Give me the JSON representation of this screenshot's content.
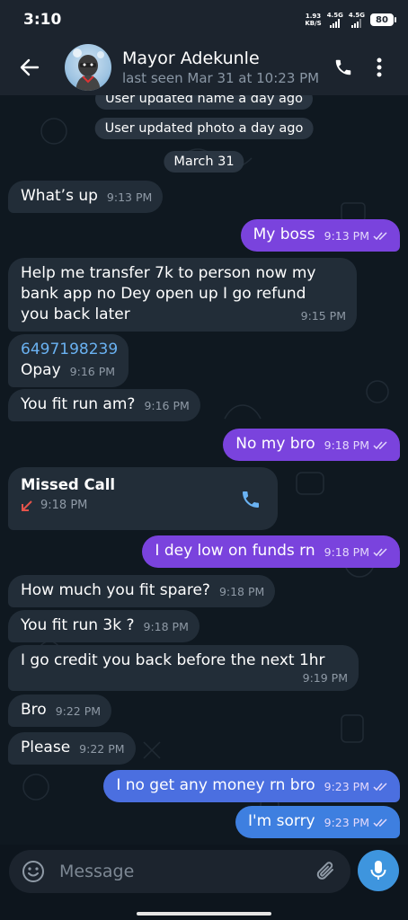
{
  "status_bar": {
    "time": "3:10",
    "net_speed_value": "1.93",
    "net_speed_unit": "KB/S",
    "sim1_label": "4.5G",
    "sim2_label": "4.5G",
    "battery": "80"
  },
  "header": {
    "contact_name": "Mayor Adekunle",
    "last_seen": "last seen Mar 31 at 10:23 PM"
  },
  "chat": {
    "service_messages": [
      "User updated name a day ago",
      "User updated photo a day ago",
      "March 31"
    ],
    "messages": [
      {
        "direction": "in",
        "text": "What’s up",
        "time": "9:13 PM"
      },
      {
        "direction": "out",
        "text": "My boss",
        "time": "9:13 PM",
        "read": true
      },
      {
        "direction": "in",
        "lines": [
          "Help me transfer 7k to person now my",
          "bank app no Dey open up I go refund",
          "you back later"
        ],
        "time": "9:15 PM"
      },
      {
        "direction": "in",
        "link": "6497198239",
        "text": "Opay",
        "time": "9:16 PM"
      },
      {
        "direction": "in",
        "text": "You fit run am?",
        "time": "9:16 PM"
      },
      {
        "direction": "out",
        "text": "No my bro",
        "time": "9:18 PM",
        "read": true
      },
      {
        "direction": "out",
        "text": "I dey low on funds rn",
        "time": "9:18 PM",
        "read": true
      },
      {
        "direction": "in",
        "text": "How much you fit spare?",
        "time": "9:18 PM"
      },
      {
        "direction": "in",
        "text": "You fit run 3k ?",
        "time": "9:18 PM"
      },
      {
        "direction": "in",
        "text": "I go credit you back before the next 1hr",
        "time": "9:19 PM"
      },
      {
        "direction": "in",
        "text": "Bro",
        "time": "9:22 PM"
      },
      {
        "direction": "in",
        "text": "Please",
        "time": "9:22 PM"
      },
      {
        "direction": "out",
        "text": "I no get any money rn bro",
        "time": "9:23 PM",
        "read": true
      },
      {
        "direction": "out",
        "text": "I'm sorry",
        "time": "9:23 PM",
        "read": true
      }
    ],
    "missed_call": {
      "title": "Missed Call",
      "time": "9:18 PM"
    }
  },
  "input": {
    "placeholder": "Message"
  },
  "icons": {
    "back": "arrow-left-icon",
    "phone": "phone-icon",
    "menu": "more-vert-icon",
    "emoji": "emoji-icon",
    "attach": "paperclip-icon",
    "mic": "microphone-icon",
    "missed_call_arrow": "missed-call-arrow-icon",
    "read_ticks": "double-check-icon"
  },
  "colors": {
    "header_bg": "#1c242e",
    "incoming_bubble": "#222d38",
    "outgoing_bubble": "#7a43dd",
    "accent_blue": "#3e95de",
    "link": "#6ab2f2",
    "missed_red": "#e5534b"
  }
}
